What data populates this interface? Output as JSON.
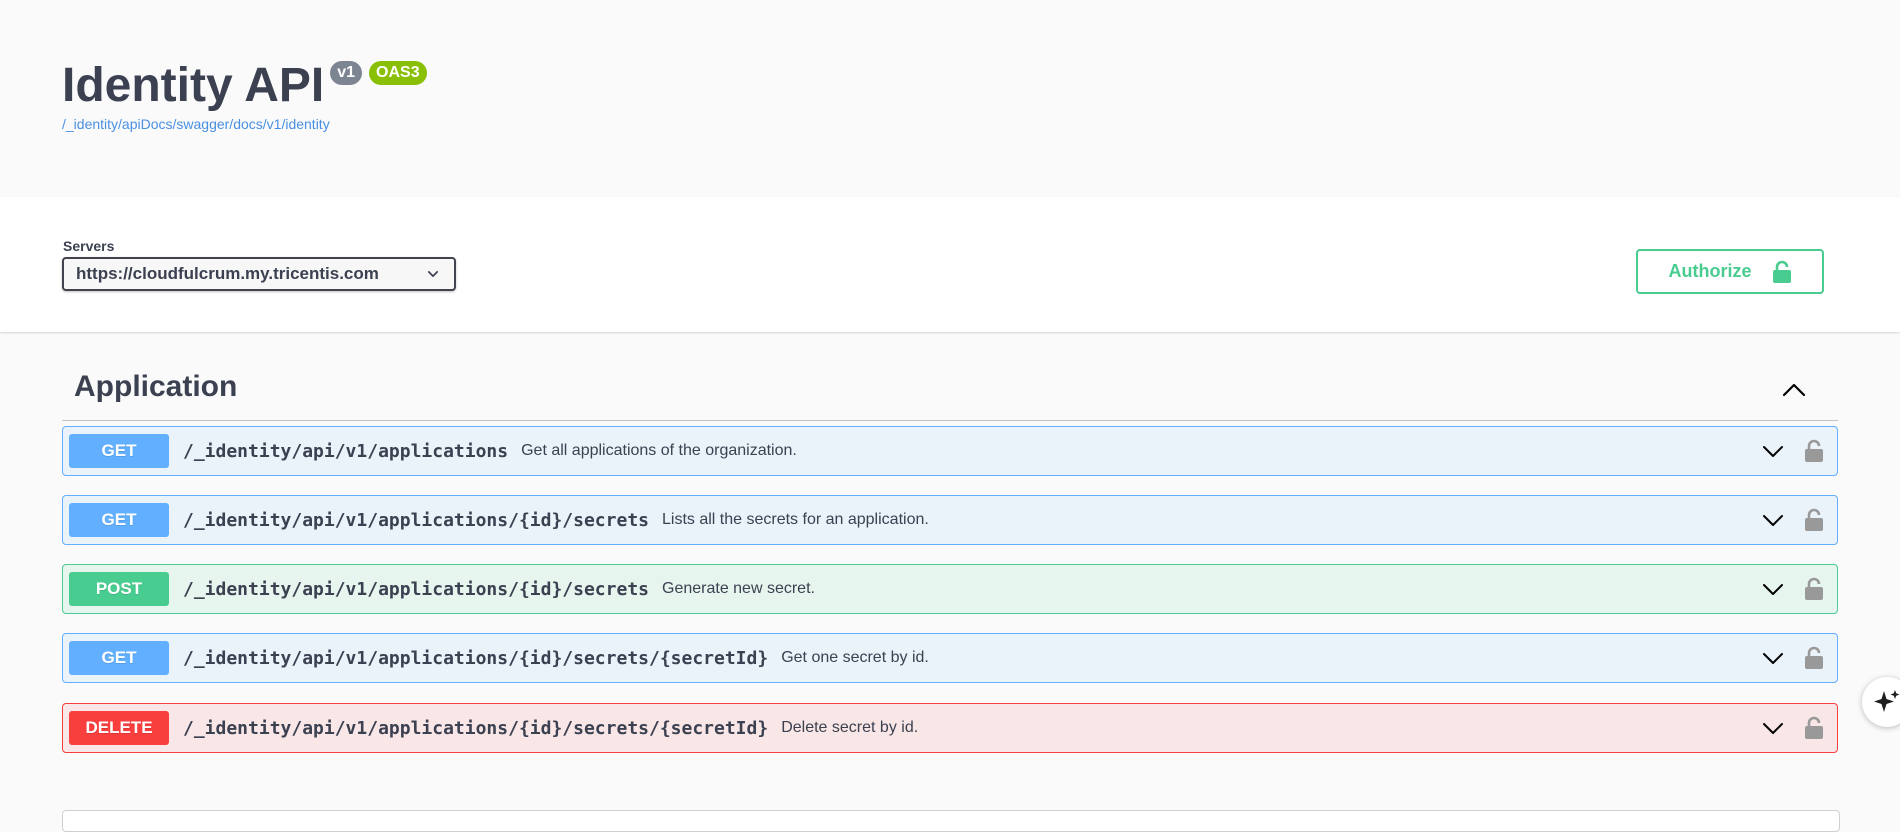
{
  "info": {
    "title": "Identity API",
    "version_badge": "v1",
    "oas_badge": "OAS3",
    "spec_url": "/_identity/apiDocs/swagger/docs/v1/identity"
  },
  "servers": {
    "label": "Servers",
    "selected": "https://cloudfulcrum.my.tricentis.com"
  },
  "authorize": {
    "label": "Authorize"
  },
  "tag": {
    "name": "Application",
    "operations": [
      {
        "method": "GET",
        "path": "/_identity/api/v1/applications",
        "summary": "Get all applications of the organization."
      },
      {
        "method": "GET",
        "path": "/_identity/api/v1/applications/{id}/secrets",
        "summary": "Lists all the secrets for an application."
      },
      {
        "method": "POST",
        "path": "/_identity/api/v1/applications/{id}/secrets",
        "summary": "Generate new secret."
      },
      {
        "method": "GET",
        "path": "/_identity/api/v1/applications/{id}/secrets/{secretId}",
        "summary": "Get one secret by id."
      },
      {
        "method": "DELETE",
        "path": "/_identity/api/v1/applications/{id}/secrets/{secretId}",
        "summary": "Delete secret by id."
      }
    ]
  },
  "colors": {
    "get": "#61affe",
    "post": "#49cc90",
    "delete": "#f93e3e",
    "authorize": "#49cc90",
    "link": "#4990e2"
  },
  "icons": {
    "server_dropdown": "chevron-down-icon",
    "authorize_lock": "lock-open-icon",
    "tag_toggle": "chevron-up-icon",
    "operation_toggle": "chevron-down-icon",
    "operation_lock": "lock-open-icon",
    "fab": "sparkles-icon"
  }
}
